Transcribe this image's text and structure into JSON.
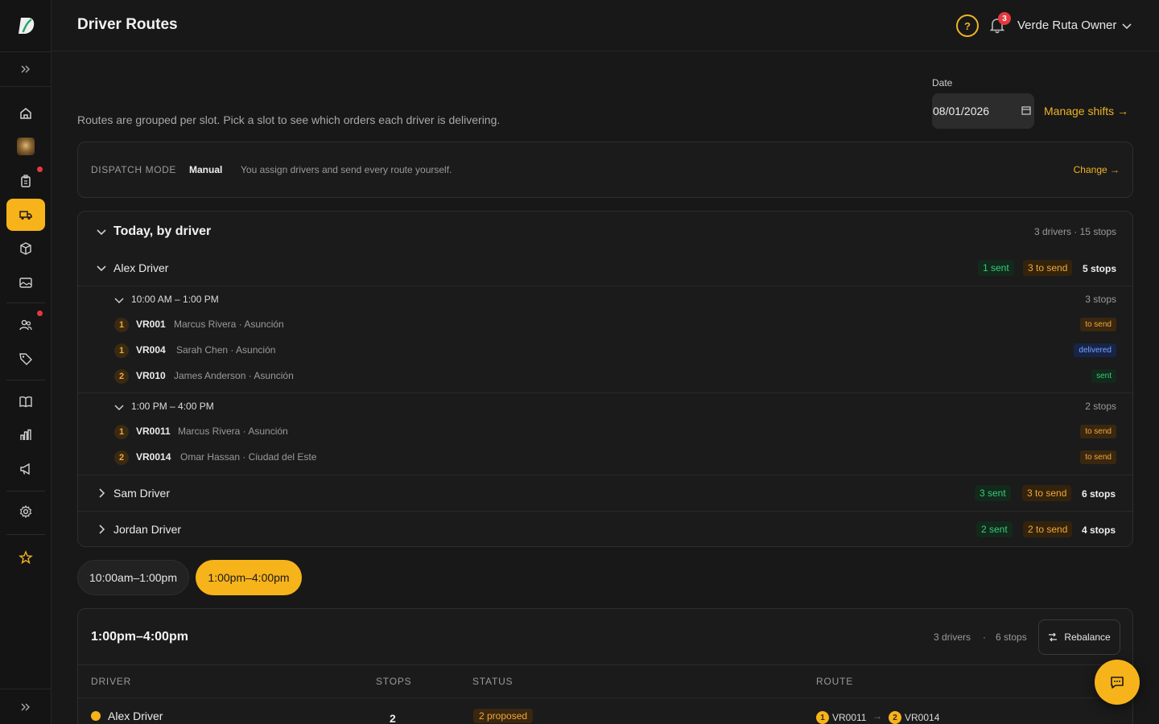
{
  "header": {
    "title": "Driver Routes",
    "help_icon": "help-circle-icon",
    "notifications_count": "3",
    "user_name": "Verde Ruta Owner"
  },
  "sidebar": {
    "items": [
      {
        "name": "home",
        "icon": "home-icon"
      },
      {
        "name": "store",
        "icon": "store-avatar-icon"
      },
      {
        "name": "orders",
        "icon": "clipboard-icon",
        "dot": true
      },
      {
        "name": "driver-routes",
        "icon": "truck-icon",
        "active": true
      },
      {
        "name": "products",
        "icon": "box-icon"
      },
      {
        "name": "media",
        "icon": "image-icon"
      },
      {
        "name": "customers",
        "icon": "users-icon",
        "dot": true
      },
      {
        "name": "discounts",
        "icon": "tag-icon"
      },
      {
        "name": "catalog",
        "icon": "book-icon"
      },
      {
        "name": "analytics",
        "icon": "bar-chart-icon"
      },
      {
        "name": "marketing",
        "icon": "megaphone-icon"
      },
      {
        "name": "settings",
        "icon": "gear-icon"
      },
      {
        "name": "favorites",
        "icon": "star-icon"
      }
    ]
  },
  "main": {
    "subtitle": "Routes are grouped per slot. Pick a slot to see which orders each driver is delivering.",
    "date_label": "Date",
    "date_value": "08/01/2026",
    "manage_shifts": "Manage shifts →"
  },
  "dispatch": {
    "label": "DISPATCH MODE",
    "value": "Manual",
    "description": "You assign drivers and send every route yourself.",
    "change": "Change →"
  },
  "today": {
    "title": "Today, by driver",
    "summary": "3 drivers · 15 stops",
    "drivers": [
      {
        "name": "Alex Driver",
        "sent": "1 sent",
        "to_send": "3 to send",
        "stops": "5 stops",
        "slots": [
          {
            "time": "10:00 AM – 1:00 PM",
            "count": "3 stops",
            "orders": [
              {
                "seq": "1",
                "id": "VR001",
                "meta": "Marcus Rivera · Asunción",
                "status": "to send"
              },
              {
                "seq": "1",
                "id": "VR004",
                "meta": "Sarah Chen · Asunción",
                "status": "delivered"
              },
              {
                "seq": "2",
                "id": "VR010",
                "meta": "James Anderson · Asunción",
                "status": "sent"
              }
            ]
          },
          {
            "time": "1:00 PM – 4:00 PM",
            "count": "2 stops",
            "orders": [
              {
                "seq": "1",
                "id": "VR0011",
                "meta": "Marcus Rivera · Asunción",
                "status": "to send"
              },
              {
                "seq": "2",
                "id": "VR0014",
                "meta": "Omar Hassan · Ciudad del Este",
                "status": "to send"
              }
            ]
          }
        ]
      },
      {
        "name": "Sam Driver",
        "sent": "3 sent",
        "to_send": "3 to send",
        "stops": "6 stops"
      },
      {
        "name": "Jordan Driver",
        "sent": "2 sent",
        "to_send": "2 to send",
        "stops": "4 stops"
      }
    ]
  },
  "slot_tabs": [
    "10:00am–1:00pm",
    "1:00pm–4:00pm"
  ],
  "slot_detail": {
    "title": "1:00pm–4:00pm",
    "drivers": "3 drivers",
    "separator": "·",
    "stops": "6 stops",
    "rebalance": "Rebalance",
    "columns": [
      "DRIVER",
      "STOPS",
      "STATUS",
      "ROUTE"
    ],
    "rows": [
      {
        "driver": "Alex Driver",
        "stops": "2",
        "status": "2 proposed",
        "route": [
          {
            "seq": "1",
            "id": "VR0011"
          },
          {
            "seq": "2",
            "id": "VR0014"
          }
        ],
        "arrow": "→"
      }
    ]
  },
  "colors": {
    "accent": "#f7b31a",
    "sent": "#3cc97a",
    "to_send": "#f0a83a",
    "delivered": "#7aa2ff",
    "bg": "#181818"
  }
}
